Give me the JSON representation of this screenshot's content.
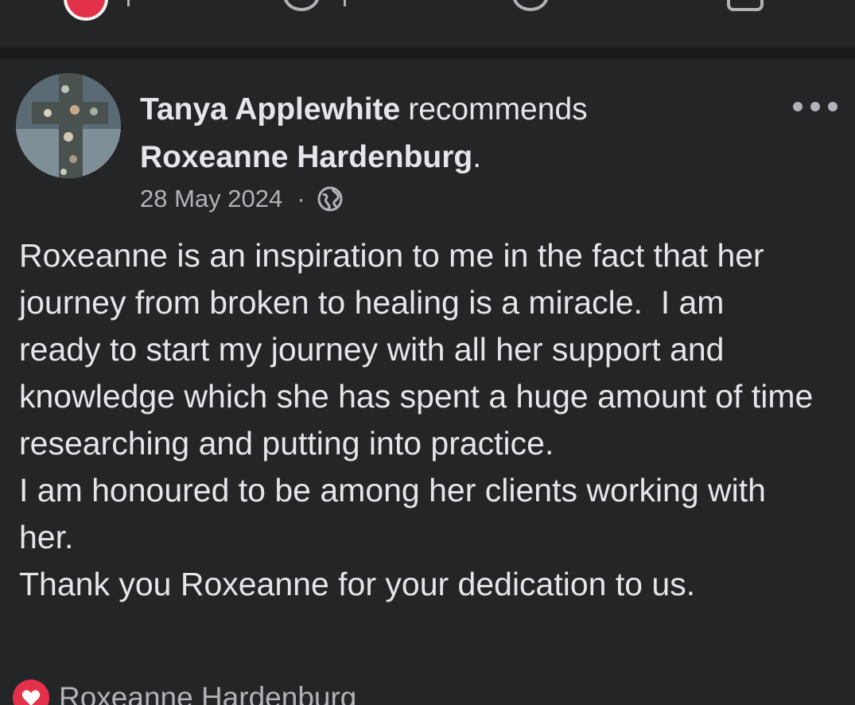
{
  "previous_post": {
    "actions": [
      "react",
      "comment",
      "send",
      "share"
    ]
  },
  "post": {
    "author": "Tanya Applewhite",
    "action_word": "recommends",
    "target": "Roxeanne Hardenburg",
    "date": "28 May 2024",
    "separator": "·",
    "privacy_icon": "globe-icon",
    "more_icon": "more-options-icon",
    "body": [
      "Roxeanne is an inspiration to me in the fact that her journey from broken to healing is a miracle.  I am ready to start my journey with all her support and knowledge which she has spent a huge amount of time researching and putting into practice.",
      "I am honoured to be among her clients working with her.",
      "Thank you Roxeanne for your dedication to us."
    ],
    "reactions": {
      "icon": "love-icon",
      "text": "Roxeanne Hardenburg"
    }
  },
  "colors": {
    "background": "#242526",
    "separator": "#18191a",
    "primary_text": "#e4e6eb",
    "secondary_text": "#b0b3b8",
    "love_red": "#e4314a"
  }
}
